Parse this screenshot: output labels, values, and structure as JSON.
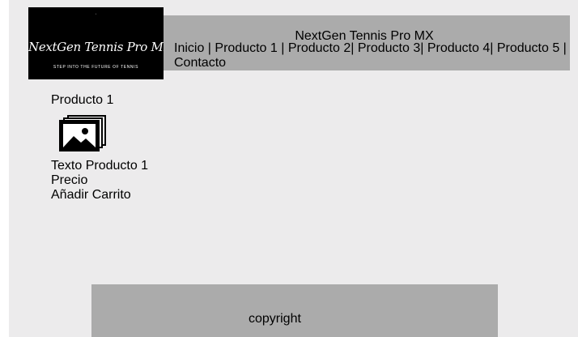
{
  "logo": {
    "script_text": "NextGen Tennis Pro Mx",
    "tagline": "STEP INTO THE FUTURE OF TENNIS"
  },
  "header": {
    "title": "NextGen Tennis Pro MX",
    "nav": {
      "inicio": "Inicio",
      "producto1": "Producto 1",
      "producto2": "Producto 2",
      "producto3": "Producto 3",
      "producto4": "Producto 4",
      "producto5": "Producto 5",
      "contacto": "Contacto"
    }
  },
  "product": {
    "title": "Producto 1",
    "image_icon": "image-gallery-icon",
    "text": "Texto Producto 1",
    "price": "Precio",
    "add_to_cart": "Añadir Carrito"
  },
  "footer": {
    "text": "copyright"
  },
  "colors": {
    "page_background": "#ecebec",
    "bar_background": "#ababab",
    "logo_background": "#000000"
  }
}
